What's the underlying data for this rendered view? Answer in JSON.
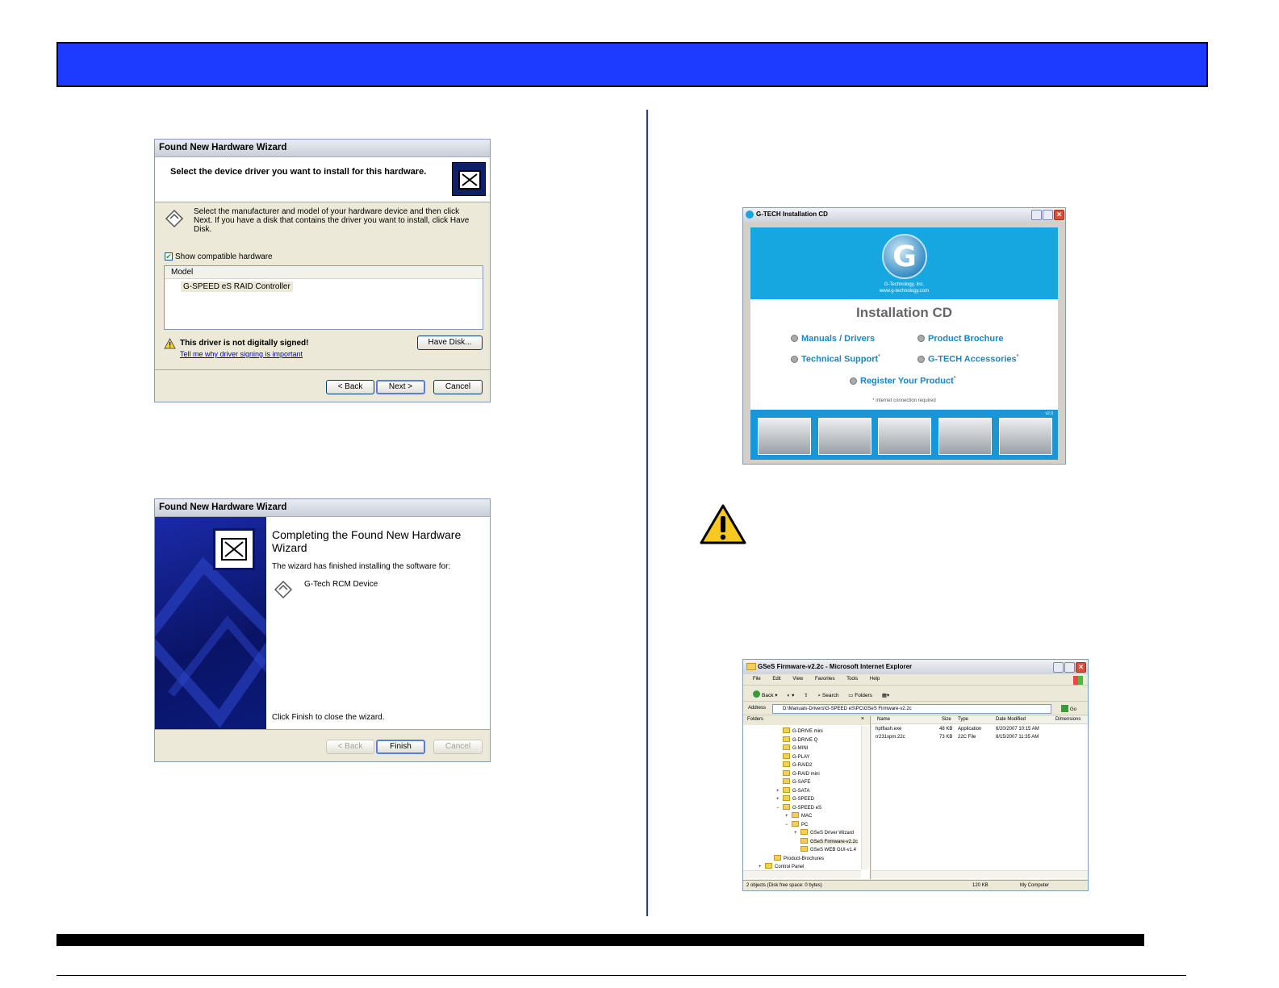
{
  "wizard1": {
    "title": "Found New Hardware Wizard",
    "heading": "Select the device driver you want to install for this hardware.",
    "description": "Select the manufacturer and model of your hardware device and then click Next. If you have a disk that contains the driver you want to install, click Have Disk.",
    "show_compatible_label": "Show compatible hardware",
    "show_compatible_checked": true,
    "column_model": "Model",
    "model_rows": [
      "G-SPEED eS RAID Controller"
    ],
    "warning": "This driver is not digitally signed!",
    "warning_link": "Tell me why driver signing is important",
    "have_disk_button": "Have Disk...",
    "back_button": "< Back",
    "next_button": "Next >",
    "cancel_button": "Cancel"
  },
  "wizard2": {
    "title": "Found New Hardware Wizard",
    "heading": "Completing the Found New Hardware Wizard",
    "subtext": "The wizard has finished installing the software for:",
    "device": "G-Tech RCM Device",
    "close_text": "Click Finish to close the wizard.",
    "back_button": "< Back",
    "finish_button": "Finish",
    "cancel_button": "Cancel"
  },
  "gtech_cd": {
    "title": "G-TECH Installation CD",
    "logo_letter": "G",
    "company": "G-Technology, Inc.",
    "url": "www.g-technology.com",
    "heading": "Installation CD",
    "links": {
      "manuals": "Manuals / Drivers",
      "brochure": "Product Brochure",
      "support": "Technical Support",
      "accessories": "G-TECH Accessories",
      "register": "Register Your Product"
    },
    "asterisk": "*",
    "note": "* internet connection required",
    "version": "v2.0"
  },
  "explorer": {
    "title": "GSeS Firmware-v2.2c - Microsoft Internet Explorer",
    "menu": [
      "File",
      "Edit",
      "View",
      "Favorites",
      "Tools",
      "Help"
    ],
    "toolbar": {
      "back": "Back",
      "search": "Search",
      "folders": "Folders"
    },
    "address_label": "Address",
    "address_value": "D:\\Manuals-Drivers\\G-SPEED eS\\PC\\GSeS Firmware-v2.2c",
    "go_label": "Go",
    "folders_header": "Folders",
    "folders_close": "×",
    "tree": [
      {
        "label": "G-DRIVE mini",
        "level": 3,
        "expander": ""
      },
      {
        "label": "G-DRIVE Q",
        "level": 3,
        "expander": ""
      },
      {
        "label": "G-MINI",
        "level": 3,
        "expander": ""
      },
      {
        "label": "G-PLAY",
        "level": 3,
        "expander": ""
      },
      {
        "label": "G-RAID2",
        "level": 3,
        "expander": ""
      },
      {
        "label": "G-RAID mini",
        "level": 3,
        "expander": ""
      },
      {
        "label": "G-SAFE",
        "level": 3,
        "expander": ""
      },
      {
        "label": "G-SATA",
        "level": 3,
        "expander": "+"
      },
      {
        "label": "G-SPEED",
        "level": 3,
        "expander": "+"
      },
      {
        "label": "G-SPEED eS",
        "level": 3,
        "expander": "−"
      },
      {
        "label": "MAC",
        "level": 4,
        "expander": "+"
      },
      {
        "label": "PC",
        "level": 4,
        "expander": "−"
      },
      {
        "label": "GSeS Driver Wizard",
        "level": 5,
        "expander": "+"
      },
      {
        "label": "GSeS Firmware-v2.2c",
        "level": 5,
        "expander": "",
        "selected": true
      },
      {
        "label": "GSeS WEB GUI-v1.4",
        "level": 5,
        "expander": ""
      },
      {
        "label": "Product-Brochures",
        "level": 2,
        "expander": ""
      },
      {
        "label": "Control Panel",
        "level": 1,
        "expander": "+"
      }
    ],
    "columns": [
      "Name",
      "Size",
      "Type",
      "Date Modified",
      "Dimensions"
    ],
    "files": [
      {
        "name": "hptflash.exe",
        "size": "48 KB",
        "type": "Application",
        "date": "6/20/2007 10:15 AM"
      },
      {
        "name": "rr231xpm.22c",
        "size": "73 KB",
        "type": "22C File",
        "date": "8/15/2007 11:35 AM"
      }
    ],
    "status_objects": "2 objects (Disk free space: 0 bytes)",
    "status_size": "120 KB",
    "status_zone": "My Computer"
  }
}
